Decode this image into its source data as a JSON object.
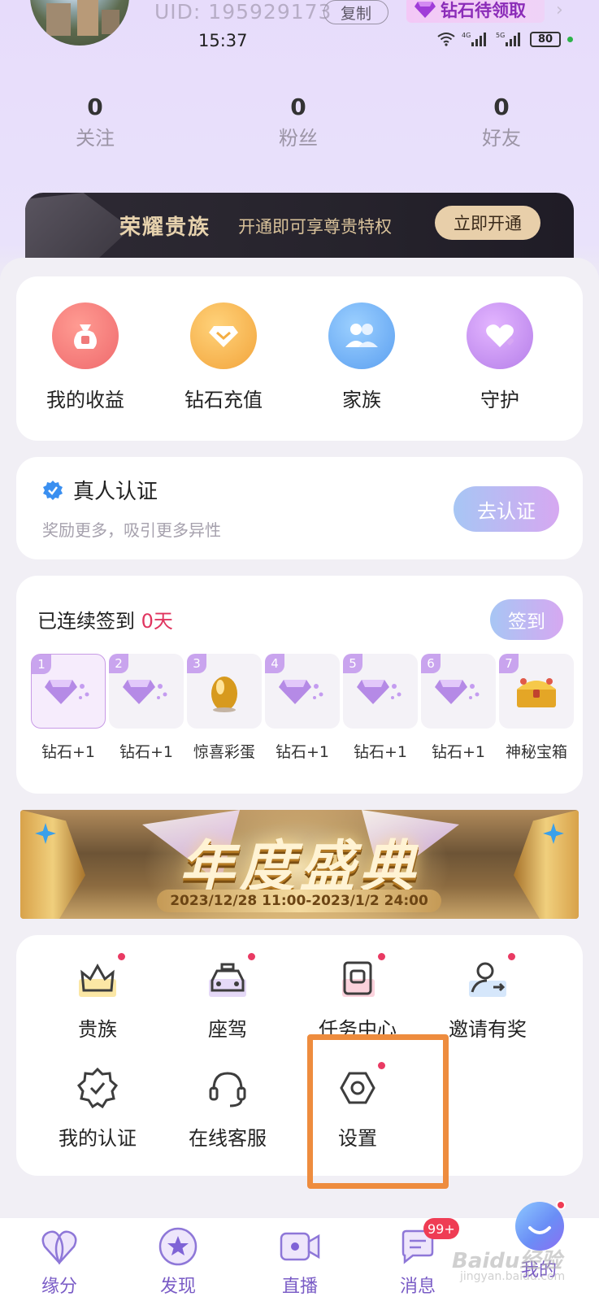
{
  "header": {
    "uid": "UID: 195929173",
    "copy_label": "复制",
    "diamond_chip": "钻石待领取",
    "time": "15:37",
    "network_4g": "4G",
    "network_5g": "5G",
    "battery": "80",
    "stats": [
      {
        "num": "0",
        "label": "关注"
      },
      {
        "num": "0",
        "label": "粉丝"
      },
      {
        "num": "0",
        "label": "好友"
      }
    ]
  },
  "noble_banner": {
    "title": "荣耀贵族",
    "subtitle": "开通即可享尊贵特权",
    "button": "立即开通"
  },
  "quick": [
    {
      "label": "我的收益",
      "icon": "money-bag-icon",
      "color": "#f47a78"
    },
    {
      "label": "钻石充值",
      "icon": "diamond-icon",
      "color": "#f6b24a"
    },
    {
      "label": "家族",
      "icon": "family-icon",
      "color": "#63a9f3"
    },
    {
      "label": "守护",
      "icon": "heart-icon",
      "color": "#c58ef0"
    }
  ],
  "verify": {
    "title": "真人认证",
    "subtitle": "奖励更多，吸引更多异性",
    "button": "去认证"
  },
  "signin": {
    "title_prefix": "已连续签到 ",
    "days_count": "0天",
    "button": "签到",
    "days": [
      {
        "n": "1",
        "caption": "钻石+1",
        "reward": "diamond"
      },
      {
        "n": "2",
        "caption": "钻石+1",
        "reward": "diamond"
      },
      {
        "n": "3",
        "caption": "惊喜彩蛋",
        "reward": "egg"
      },
      {
        "n": "4",
        "caption": "钻石+1",
        "reward": "diamond"
      },
      {
        "n": "5",
        "caption": "钻石+1",
        "reward": "diamond"
      },
      {
        "n": "6",
        "caption": "钻石+1",
        "reward": "diamond"
      },
      {
        "n": "7",
        "caption": "神秘宝箱",
        "reward": "chest"
      }
    ]
  },
  "promo": {
    "title": "年度盛典",
    "date": "2023/12/28 11:00-2023/1/2 24:00"
  },
  "tools": [
    {
      "label": "贵族",
      "icon": "crown-icon"
    },
    {
      "label": "座驾",
      "icon": "car-icon"
    },
    {
      "label": "任务中心",
      "icon": "task-icon"
    },
    {
      "label": "邀请有奖",
      "icon": "invite-icon"
    },
    {
      "label": "我的认证",
      "icon": "badge-check-icon"
    },
    {
      "label": "在线客服",
      "icon": "headset-icon"
    },
    {
      "label": "设置",
      "icon": "gear-icon"
    }
  ],
  "tabbar": [
    {
      "label": "缘分",
      "icon": "heart-outline-icon"
    },
    {
      "label": "发现",
      "icon": "star-circle-icon"
    },
    {
      "label": "直播",
      "icon": "video-icon"
    },
    {
      "label": "消息",
      "icon": "message-icon",
      "badge": "99+"
    },
    {
      "label": "我的",
      "icon": "smile-bubble-icon"
    }
  ],
  "watermark": {
    "brand": "Baidu经验",
    "url": "jingyan.baidu.com"
  }
}
